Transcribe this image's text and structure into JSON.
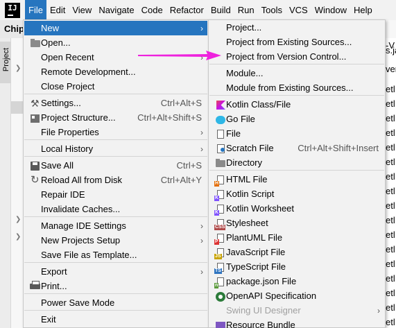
{
  "menubar": {
    "logo": "IJ",
    "items": [
      "File",
      "Edit",
      "View",
      "Navigate",
      "Code",
      "Refactor",
      "Build",
      "Run",
      "Tools",
      "VCS",
      "Window",
      "Help"
    ],
    "active_index": 0
  },
  "ide": {
    "project_title": "Chip",
    "side_tab": "Project",
    "right_snippets": [
      "-V",
      "s.ja",
      "ver",
      "etl",
      "etl",
      "etl",
      "etl",
      "etl",
      "etl",
      "etl",
      "etl",
      "etl",
      "etl",
      "etl",
      "etl",
      "etl",
      "etl",
      "etl",
      "etl",
      "etl"
    ]
  },
  "file_menu": {
    "items": [
      {
        "label": "New",
        "submenu": true,
        "highlighted": true,
        "icon": ""
      },
      {
        "label": "Open...",
        "icon": "folder-icon"
      },
      {
        "label": "Open Recent",
        "submenu": true,
        "icon": ""
      },
      {
        "label": "Remote Development...",
        "icon": ""
      },
      {
        "label": "Close Project",
        "icon": ""
      },
      {
        "label": "Settings...",
        "shortcut": "Ctrl+Alt+S",
        "icon": "wrench-icon"
      },
      {
        "label": "Project Structure...",
        "shortcut": "Ctrl+Alt+Shift+S",
        "icon": "project-structure-icon"
      },
      {
        "label": "File Properties",
        "submenu": true,
        "icon": ""
      },
      {
        "label": "Local History",
        "submenu": true,
        "icon": ""
      },
      {
        "label": "Save All",
        "shortcut": "Ctrl+S",
        "icon": "save-icon"
      },
      {
        "label": "Reload All from Disk",
        "shortcut": "Ctrl+Alt+Y",
        "icon": "reload-icon"
      },
      {
        "label": "Repair IDE",
        "icon": ""
      },
      {
        "label": "Invalidate Caches...",
        "icon": ""
      },
      {
        "label": "Manage IDE Settings",
        "submenu": true,
        "icon": ""
      },
      {
        "label": "New Projects Setup",
        "submenu": true,
        "icon": ""
      },
      {
        "label": "Save File as Template...",
        "icon": ""
      },
      {
        "label": "Export",
        "submenu": true,
        "icon": ""
      },
      {
        "label": "Print...",
        "icon": "printer-icon"
      },
      {
        "label": "Power Save Mode",
        "icon": ""
      },
      {
        "label": "Exit",
        "icon": ""
      }
    ]
  },
  "new_menu": {
    "items": [
      {
        "label": "Project...",
        "icon": ""
      },
      {
        "label": "Project from Existing Sources...",
        "icon": ""
      },
      {
        "label": "Project from Version Control...",
        "icon": ""
      },
      {
        "label": "Module...",
        "icon": ""
      },
      {
        "label": "Module from Existing Sources...",
        "icon": ""
      },
      {
        "label": "Kotlin Class/File",
        "icon": "kotlin-icon"
      },
      {
        "label": "Go File",
        "icon": "go-file-icon"
      },
      {
        "label": "File",
        "icon": "file-icon"
      },
      {
        "label": "Scratch File",
        "shortcut": "Ctrl+Alt+Shift+Insert",
        "icon": "scratch-file-icon"
      },
      {
        "label": "Directory",
        "icon": "folder-icon"
      },
      {
        "label": "HTML File",
        "icon": "html-file-icon"
      },
      {
        "label": "Kotlin Script",
        "icon": "kotlin-script-icon"
      },
      {
        "label": "Kotlin Worksheet",
        "icon": "kotlin-worksheet-icon"
      },
      {
        "label": "Stylesheet",
        "icon": "css-file-icon"
      },
      {
        "label": "PlantUML File",
        "icon": "plantuml-icon"
      },
      {
        "label": "JavaScript File",
        "icon": "js-file-icon"
      },
      {
        "label": "TypeScript File",
        "icon": "ts-file-icon"
      },
      {
        "label": "package.json File",
        "icon": "npm-icon"
      },
      {
        "label": "OpenAPI Specification",
        "icon": "openapi-icon"
      },
      {
        "label": "Swing UI Designer",
        "submenu": true,
        "disabled": true,
        "icon": ""
      },
      {
        "label": "Resource Bundle",
        "icon": "resource-bundle-icon"
      }
    ]
  },
  "colors": {
    "highlight": "#2675bf",
    "annotation_arrow": "#ee22dd"
  }
}
